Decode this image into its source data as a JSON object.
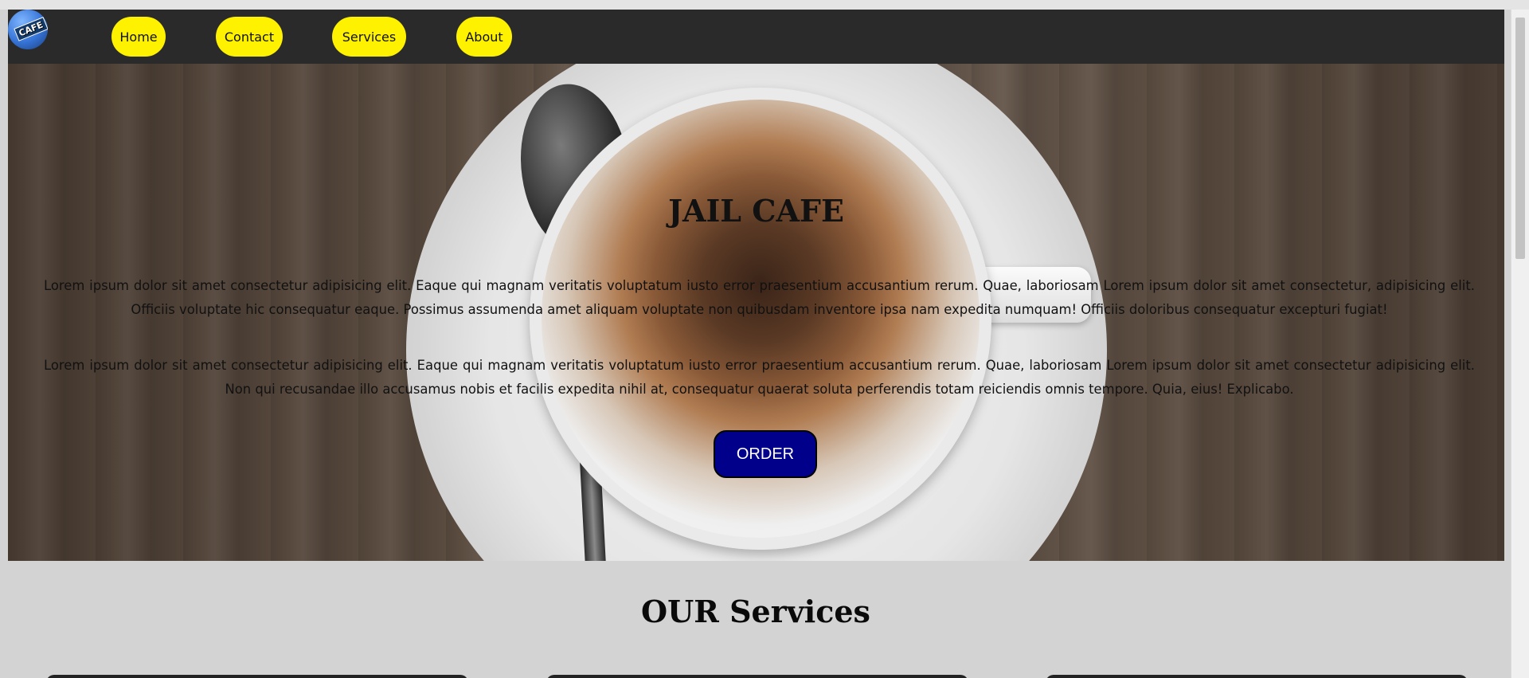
{
  "nav": {
    "logo_text": "CAFE",
    "items": [
      {
        "label": "Home"
      },
      {
        "label": "Contact"
      },
      {
        "label": "Services"
      },
      {
        "label": "About"
      }
    ]
  },
  "hero": {
    "title": "JAIL CAFE",
    "paragraphs": [
      "Lorem ipsum dolor sit amet consectetur adipisicing elit. Eaque qui magnam veritatis voluptatum iusto error praesentium accusantium rerum. Quae, laboriosam Lorem ipsum dolor sit amet consectetur, adipisicing elit. Officiis voluptate hic consequatur eaque. Possimus assumenda amet aliquam voluptate non quibusdam inventore ipsa nam expedita numquam! Officiis doloribus consequatur excepturi fugiat!",
      "Lorem ipsum dolor sit amet consectetur adipisicing elit. Eaque qui magnam veritatis voluptatum iusto error praesentium accusantium rerum. Quae, laboriosam Lorem ipsum dolor sit amet consectetur adipisicing elit. Non qui recusandae illo accusamus nobis et facilis expedita nihil at, consequatur quaerat soluta perferendis totam reiciendis omnis tempore. Quia, eius! Explicabo."
    ],
    "order_label": "ORDER"
  },
  "services": {
    "title": "OUR Services"
  },
  "colors": {
    "nav_background": "#2a2a2a",
    "nav_button": "#fff200",
    "order_button": "#00008b",
    "page_background": "#d3d3d3"
  }
}
